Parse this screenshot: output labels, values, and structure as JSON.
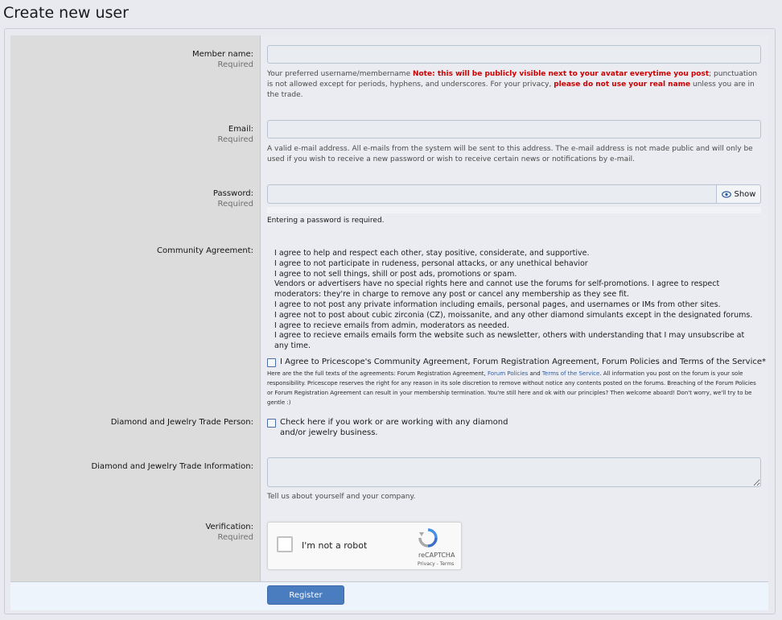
{
  "page": {
    "title": "Create new user"
  },
  "fields": {
    "member_name": {
      "label": "Member name:",
      "required": "Required",
      "value": "",
      "help_prefix": "Your preferred username/membername ",
      "help_red1": "Note: this will be publicly visible next to your avatar everytime you post",
      "help_mid": "; punctuation is not allowed except for periods, hyphens, and underscores. For your privacy, ",
      "help_red2": "please do not use your real name",
      "help_suffix": " unless you are in the trade."
    },
    "email": {
      "label": "Email:",
      "required": "Required",
      "value": "",
      "help": "A valid e-mail address. All e-mails from the system will be sent to this address. The e-mail address is not made public and will only be used if you wish to receive a new password or wish to receive certain news or notifications by e-mail."
    },
    "password": {
      "label": "Password:",
      "required": "Required",
      "value": "",
      "show_label": "Show",
      "help": "Entering a password is required."
    },
    "community_agreement": {
      "label": "Community Agreement:",
      "items": [
        "I agree to help and respect each other, stay positive, considerate, and supportive.",
        "I agree to not participate in rudeness, personal attacks, or any unethical behavior",
        "I agree to not sell things, shill or post ads, promotions or spam.",
        "Vendors or advertisers have no special rights here and cannot use the forums for self-promotions. I agree to respect moderators: they're in charge to remove any post or cancel any membership as they see fit.",
        "I agree to not post any private information including emails, personal pages, and usernames or IMs from other sites.",
        "I agree not to post about cubic zirconia (CZ), moissanite, and any other diamond simulants except in the designated forums.",
        "I agree to recieve emails from admin, moderators as needed.",
        "I agree to recieve emails emails form the website such as newsletter, others with understanding that I may unsubscribe at any time."
      ],
      "checkbox_label": "I Agree to Pricescope's Community Agreement, Forum Registration Agreement, Forum Policies and Terms of the Service*",
      "fine_1": "Here are the the full texts of the agreements: Forum Registration Agreement, ",
      "fine_link1": "Forum Policies",
      "fine_2": " and ",
      "fine_link2": "Terms of the Service",
      "fine_3": ". All information you post on the forum is your sole responsibility. Pricescope reserves the right for any reason in its sole discretion to remove without notice any contents posted on the forums. Breaching of the Forum Policies or Forum Registration Agreement can result in your membership termination. You're still here and ok with our principles? Then welcome aboard! Don't worry, we'll try to be gentle :)"
    },
    "trade_person": {
      "label": "Diamond and Jewelry Trade Person:",
      "checkbox_label_line1": "Check here if you work or are working with any diamond",
      "checkbox_label_line2": "and/or jewelry business."
    },
    "trade_info": {
      "label": "Diamond and Jewelry Trade Information:",
      "value": "",
      "help": "Tell us about yourself and your company."
    },
    "verification": {
      "label": "Verification:",
      "required": "Required",
      "captcha_text": "I'm not a robot",
      "captcha_brand": "reCAPTCHA",
      "captcha_links": "Privacy - Terms"
    }
  },
  "actions": {
    "register_label": "Register"
  },
  "colors": {
    "accent": "#4a7cc0",
    "warning_red": "#cc0000",
    "link": "#2b5ca6"
  },
  "icons": {
    "show_password": "eye-icon",
    "captcha": "recaptcha-logo-icon"
  }
}
